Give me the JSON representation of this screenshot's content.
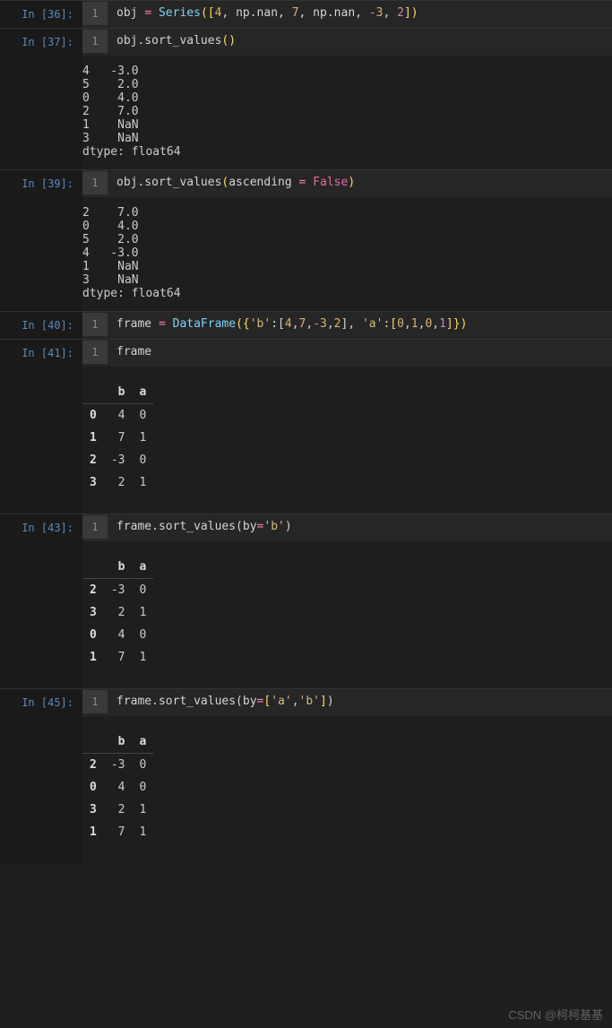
{
  "cells": [
    {
      "prompt": "In [36]:",
      "line": "1",
      "tokens": [
        {
          "t": "obj ",
          "c": "c-w"
        },
        {
          "t": "=",
          "c": "c-op"
        },
        {
          "t": " ",
          "c": "c-w"
        },
        {
          "t": "Series",
          "c": "c-fn"
        },
        {
          "t": "(",
          "c": "c-br"
        },
        {
          "t": "[",
          "c": "c-br"
        },
        {
          "t": "4",
          "c": "c-num"
        },
        {
          "t": ", np.nan, ",
          "c": "c-w"
        },
        {
          "t": "7",
          "c": "c-num"
        },
        {
          "t": ", np.nan, ",
          "c": "c-w"
        },
        {
          "t": "-",
          "c": "c-op"
        },
        {
          "t": "3",
          "c": "c-num"
        },
        {
          "t": ", ",
          "c": "c-w"
        },
        {
          "t": "2",
          "c": "c-num2"
        },
        {
          "t": "]",
          "c": "c-br"
        },
        {
          "t": ")",
          "c": "c-br"
        }
      ],
      "output_text": null,
      "output_table": null
    },
    {
      "prompt": "In [37]:",
      "line": "1",
      "tokens": [
        {
          "t": "obj.sort_values",
          "c": "c-w"
        },
        {
          "t": "(",
          "c": "c-br"
        },
        {
          "t": ")",
          "c": "c-br"
        }
      ],
      "output_text": "4   -3.0\n5    2.0\n0    4.0\n2    7.0\n1    NaN\n3    NaN\ndtype: float64",
      "output_table": null
    },
    {
      "prompt": "In [39]:",
      "line": "1",
      "tokens": [
        {
          "t": "obj.sort_values",
          "c": "c-w"
        },
        {
          "t": "(",
          "c": "c-br"
        },
        {
          "t": "ascending ",
          "c": "c-w"
        },
        {
          "t": "=",
          "c": "c-op"
        },
        {
          "t": " ",
          "c": "c-w"
        },
        {
          "t": "False",
          "c": "c-kw"
        },
        {
          "t": ")",
          "c": "c-br"
        }
      ],
      "output_text": "2    7.0\n0    4.0\n5    2.0\n4   -3.0\n1    NaN\n3    NaN\ndtype: float64",
      "output_table": null
    },
    {
      "prompt": "In [40]:",
      "line": "1",
      "tokens": [
        {
          "t": "frame ",
          "c": "c-w"
        },
        {
          "t": "=",
          "c": "c-op"
        },
        {
          "t": " ",
          "c": "c-w"
        },
        {
          "t": "DataFrame",
          "c": "c-fn"
        },
        {
          "t": "({",
          "c": "c-br"
        },
        {
          "t": "'b'",
          "c": "c-str"
        },
        {
          "t": ":[",
          "c": "c-w"
        },
        {
          "t": "4",
          "c": "c-num"
        },
        {
          "t": ",",
          "c": "c-w"
        },
        {
          "t": "7",
          "c": "c-num"
        },
        {
          "t": ",",
          "c": "c-w"
        },
        {
          "t": "-",
          "c": "c-op"
        },
        {
          "t": "3",
          "c": "c-num"
        },
        {
          "t": ",",
          "c": "c-w"
        },
        {
          "t": "2",
          "c": "c-num"
        },
        {
          "t": "], ",
          "c": "c-w"
        },
        {
          "t": "'a'",
          "c": "c-str"
        },
        {
          "t": ":",
          "c": "c-w"
        },
        {
          "t": "[",
          "c": "c-br"
        },
        {
          "t": "0",
          "c": "c-num"
        },
        {
          "t": ",",
          "c": "c-w"
        },
        {
          "t": "1",
          "c": "c-num"
        },
        {
          "t": ",",
          "c": "c-w"
        },
        {
          "t": "0",
          "c": "c-num"
        },
        {
          "t": ",",
          "c": "c-w"
        },
        {
          "t": "1",
          "c": "c-num2"
        },
        {
          "t": "]",
          "c": "c-br"
        },
        {
          "t": "})",
          "c": "c-br"
        }
      ],
      "output_text": null,
      "output_table": null
    },
    {
      "prompt": "In [41]:",
      "line": "1",
      "tokens": [
        {
          "t": "frame",
          "c": "c-w"
        }
      ],
      "output_text": null,
      "output_table": {
        "cols": [
          "b",
          "a"
        ],
        "rows": [
          {
            "idx": "0",
            "v": [
              "4",
              "0"
            ]
          },
          {
            "idx": "1",
            "v": [
              "7",
              "1"
            ]
          },
          {
            "idx": "2",
            "v": [
              "-3",
              "0"
            ]
          },
          {
            "idx": "3",
            "v": [
              "2",
              "1"
            ]
          }
        ]
      }
    },
    {
      "prompt": "In [43]:",
      "line": "1",
      "tokens": [
        {
          "t": "frame.sort_values(by",
          "c": "c-w"
        },
        {
          "t": "=",
          "c": "c-op"
        },
        {
          "t": "'b'",
          "c": "c-str"
        },
        {
          "t": ")",
          "c": "c-w"
        }
      ],
      "output_text": null,
      "output_table": {
        "cols": [
          "b",
          "a"
        ],
        "rows": [
          {
            "idx": "2",
            "v": [
              "-3",
              "0"
            ]
          },
          {
            "idx": "3",
            "v": [
              "2",
              "1"
            ]
          },
          {
            "idx": "0",
            "v": [
              "4",
              "0"
            ]
          },
          {
            "idx": "1",
            "v": [
              "7",
              "1"
            ]
          }
        ]
      }
    },
    {
      "prompt": "In [45]:",
      "line": "1",
      "tokens": [
        {
          "t": "frame.sort_values(by",
          "c": "c-w"
        },
        {
          "t": "=",
          "c": "c-op"
        },
        {
          "t": "[",
          "c": "c-br"
        },
        {
          "t": "'a'",
          "c": "c-str"
        },
        {
          "t": ",",
          "c": "c-w"
        },
        {
          "t": "'b'",
          "c": "c-str"
        },
        {
          "t": "]",
          "c": "c-br"
        },
        {
          "t": ")",
          "c": "c-w"
        }
      ],
      "output_text": null,
      "output_table": {
        "cols": [
          "b",
          "a"
        ],
        "rows": [
          {
            "idx": "2",
            "v": [
              "-3",
              "0"
            ]
          },
          {
            "idx": "0",
            "v": [
              "4",
              "0"
            ]
          },
          {
            "idx": "3",
            "v": [
              "2",
              "1"
            ]
          },
          {
            "idx": "1",
            "v": [
              "7",
              "1"
            ]
          }
        ]
      }
    }
  ],
  "watermark": "CSDN @柯柯基基"
}
